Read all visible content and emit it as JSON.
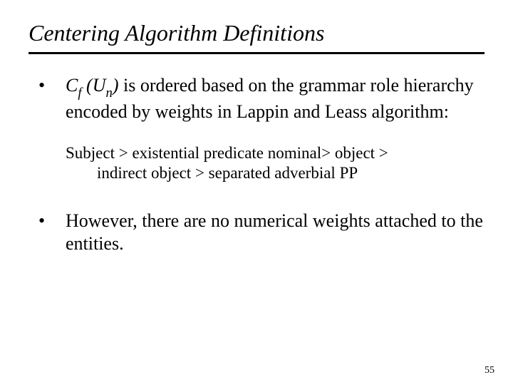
{
  "title": "Centering Algorithm Definitions",
  "bullet1": {
    "cf_c": "C",
    "cf_f": "f",
    "cf_open": " (U",
    "cf_n": "n",
    "cf_close": ")",
    "rest": " is ordered based on the grammar role hierarchy encoded by weights in Lappin and Leass algorithm:"
  },
  "hierarchy": {
    "line1": "Subject > existential predicate nominal> object >",
    "line2": "indirect object > separated adverbial PP"
  },
  "bullet2": "However, there are no numerical weights attached to the entities.",
  "pageNumber": "55"
}
